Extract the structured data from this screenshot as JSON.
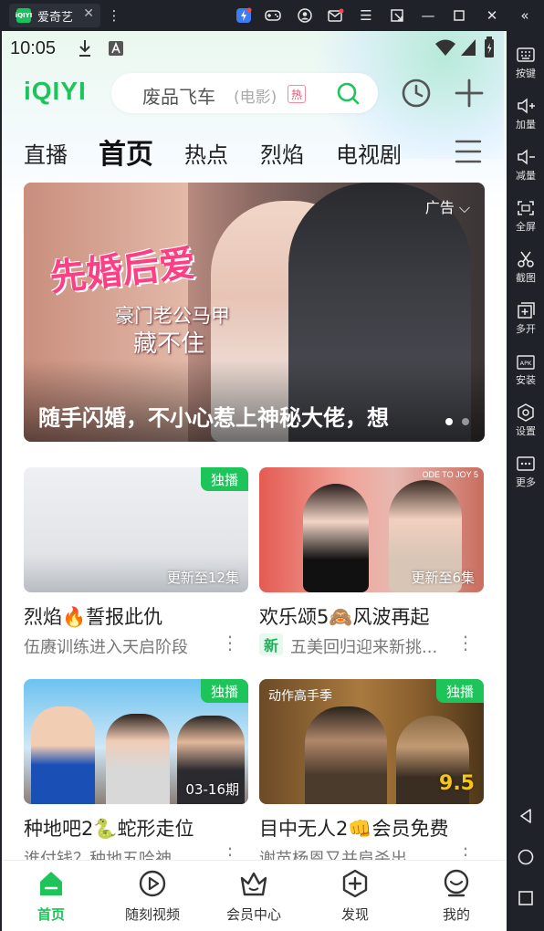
{
  "titlebar": {
    "app_title": "爱奇艺",
    "app_icon_text": "iQIYI",
    "icons": [
      "menu-dots-icon",
      "boost-icon",
      "gamepad-icon",
      "account-icon",
      "mail-icon",
      "hamburger-icon",
      "popout-icon",
      "minimize-icon",
      "maximize-icon",
      "close-icon",
      "collapse-sidebar-icon"
    ]
  },
  "sidebar": {
    "items": [
      {
        "label": "按键",
        "icon": "keyboard-icon"
      },
      {
        "label": "加量",
        "icon": "volume-up-icon"
      },
      {
        "label": "减量",
        "icon": "volume-down-icon"
      },
      {
        "label": "全屏",
        "icon": "fullscreen-icon"
      },
      {
        "label": "截图",
        "icon": "screenshot-icon"
      },
      {
        "label": "多开",
        "icon": "multi-instance-icon"
      },
      {
        "label": "安装",
        "icon": "apk-install-icon"
      },
      {
        "label": "设置",
        "icon": "settings-icon"
      },
      {
        "label": "更多",
        "icon": "more-icon"
      }
    ],
    "nav_buttons": [
      "back-icon",
      "home-icon",
      "recents-icon"
    ]
  },
  "status": {
    "time": "10:05"
  },
  "header": {
    "logo": "iQIYI",
    "search": {
      "query": "废品飞车",
      "sub": "(电影)",
      "hot_tag": "热"
    }
  },
  "channels": [
    {
      "label": "直播",
      "active": false
    },
    {
      "label": "首页",
      "active": true
    },
    {
      "label": "热点",
      "active": false
    },
    {
      "label": "烈焰",
      "active": false
    },
    {
      "label": "电视剧",
      "active": false
    }
  ],
  "banner": {
    "title_art": "先婚后爱",
    "subtitle_art_1": "豪门老公马甲",
    "subtitle_art_2": "藏不住",
    "ad_label": "广告",
    "caption": "随手闪婚，不小心惹上神秘大佬，想",
    "dots": 2,
    "active_dot": 0
  },
  "cards": [
    {
      "badge": "独播",
      "update": "更新至12集",
      "title": "烈焰🔥誓报此仇",
      "sub": "伍赓训练进入天启阶段",
      "new": false
    },
    {
      "badge": "",
      "update": "更新至6集",
      "title": "欢乐颂5🙈风波再起",
      "sub": "五美回归迎来新挑...",
      "new": true,
      "new_label": "新",
      "thumb_text": "ODE TO JOY 5"
    },
    {
      "badge": "独播",
      "update": "03-16期",
      "title": "种地吧2🐍蛇形走位",
      "sub": "谁付钱？种地五哈神",
      "new": false
    },
    {
      "badge": "独播",
      "update": "9.5",
      "title": "目中无人2👊会员免费",
      "sub": "谢苗杨恩又并肩杀出",
      "new": false,
      "thumb_text": "动作高手季"
    }
  ],
  "bottom_nav": [
    {
      "label": "首页",
      "icon": "home-icon",
      "active": true
    },
    {
      "label": "随刻视频",
      "icon": "play-circle-icon",
      "active": false
    },
    {
      "label": "会员中心",
      "icon": "crown-icon",
      "active": false
    },
    {
      "label": "发现",
      "icon": "discover-icon",
      "active": false
    },
    {
      "label": "我的",
      "icon": "profile-icon",
      "active": false
    }
  ],
  "colors": {
    "brand": "#1cc45a",
    "hot_tag": "#ef4f72",
    "emulator_bg": "#1f2229"
  }
}
